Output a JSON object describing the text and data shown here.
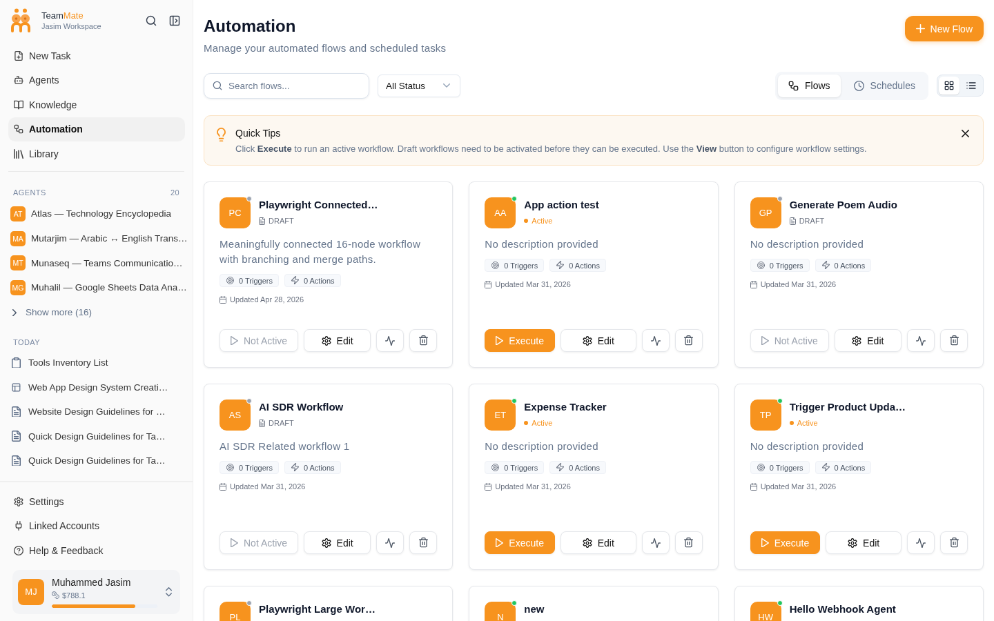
{
  "sidebar": {
    "brand": {
      "name": "Team",
      "accent": "Mate",
      "workspace": "Jasim Workspace"
    },
    "nav": [
      {
        "label": "New Task",
        "selected": false
      },
      {
        "label": "Agents",
        "selected": false
      },
      {
        "label": "Knowledge",
        "selected": false
      },
      {
        "label": "Automation",
        "selected": true
      },
      {
        "label": "Library",
        "selected": false
      }
    ],
    "agents": {
      "title": "AGENTS",
      "count": "20",
      "items": [
        {
          "initials": "AT",
          "label": "Atlas — Technology Encyclopedia"
        },
        {
          "initials": "MA",
          "label": "Mutarjim — Arabic ↔ English Trans…"
        },
        {
          "initials": "MT",
          "label": "Munaseq — Teams Communicatio…"
        },
        {
          "initials": "MG",
          "label": "Muhalil — Google Sheets Data Ana…"
        }
      ],
      "show_more": "Show more (16)"
    },
    "today": {
      "title": "TODAY",
      "items": [
        "Tools Inventory List",
        "Web App Design System Creati…",
        "Website Design Guidelines for …",
        "Quick Design Guidelines for Ta…",
        "Quick Design Guidelines for Ta…"
      ]
    },
    "footer_nav": [
      "Settings",
      "Linked Accounts",
      "Help & Feedback"
    ],
    "account": {
      "initials": "MJ",
      "name": "Muhammed Jasim",
      "balance": "$788.1",
      "level": 0.79
    }
  },
  "header": {
    "title": "Automation",
    "subtitle": "Manage your automated flows and scheduled tasks",
    "new_flow_button": "New Flow"
  },
  "toolbar": {
    "search": {
      "placeholder": "Search flows..."
    },
    "status_filter": "All Status",
    "tabs": [
      {
        "label": "Flows",
        "selected": true
      },
      {
        "label": "Schedules",
        "selected": false
      }
    ],
    "view_modes": [
      {
        "kind": "grid",
        "selected": true
      },
      {
        "kind": "list",
        "selected": false
      }
    ]
  },
  "tips": {
    "title": "Quick Tips",
    "text": "Click **Execute** to run an active workflow. Draft workflows need to be activated before they can be executed. Use the **View** button to configure workflow settings."
  },
  "cards": [
    {
      "initials": "PC",
      "title": "Playwright Connected…",
      "active": false,
      "status_label": "DRAFT",
      "description": "Meaningfully connected 16-node workflow with branching and merge paths.",
      "triggers": "0 Triggers",
      "actions": "0 Actions",
      "updated": "Updated Apr 28, 2026",
      "run_button": "Not Active",
      "edit_button": "Edit"
    },
    {
      "initials": "AA",
      "title": "App action test",
      "active": true,
      "status_label": "Active",
      "description": "No description provided",
      "triggers": "0 Triggers",
      "actions": "0 Actions",
      "updated": "Updated Mar 31, 2026",
      "run_button": "Execute",
      "edit_button": "Edit"
    },
    {
      "initials": "GP",
      "title": "Generate Poem Audio",
      "active": false,
      "status_label": "DRAFT",
      "description": "No description provided",
      "triggers": "0 Triggers",
      "actions": "0 Actions",
      "updated": "Updated Mar 31, 2026",
      "run_button": "Not Active",
      "edit_button": "Edit"
    },
    {
      "initials": "AS",
      "title": "AI SDR Workflow",
      "active": false,
      "status_label": "DRAFT",
      "description": "AI SDR Related workflow 1",
      "triggers": "0 Triggers",
      "actions": "0 Actions",
      "updated": "Updated Mar 31, 2026",
      "run_button": "Not Active",
      "edit_button": "Edit"
    },
    {
      "initials": "ET",
      "title": "Expense Tracker",
      "active": true,
      "status_label": "Active",
      "description": "No description provided",
      "triggers": "0 Triggers",
      "actions": "0 Actions",
      "updated": "Updated Mar 31, 2026",
      "run_button": "Execute",
      "edit_button": "Edit"
    },
    {
      "initials": "TP",
      "title": "Trigger Product Upda…",
      "active": true,
      "status_label": "Active",
      "description": "No description provided",
      "triggers": "0 Triggers",
      "actions": "0 Actions",
      "updated": "Updated Mar 31, 2026",
      "run_button": "Execute",
      "edit_button": "Edit"
    },
    {
      "initials": "PL",
      "title": "Playwright Large Wor…",
      "active": false
    },
    {
      "initials": "N",
      "title": "new",
      "active": true
    },
    {
      "initials": "HW",
      "title": "Hello Webhook Agent",
      "active": true
    }
  ]
}
